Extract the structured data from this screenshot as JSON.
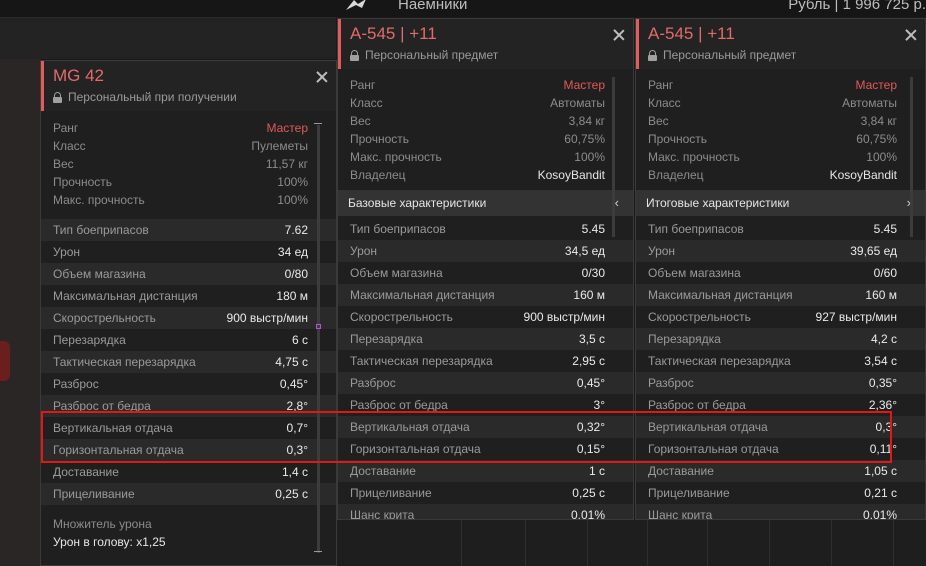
{
  "topbar": {
    "nav_label": "Наемники",
    "currency": "Рубль | 1 996 725 р."
  },
  "panels": {
    "mg42": {
      "title": "MG 42",
      "subtitle": "Персональный при получении",
      "info": [
        {
          "k": "Ранг",
          "v": "Мастер"
        },
        {
          "k": "Класс",
          "v": "Пулеметы"
        },
        {
          "k": "Вес",
          "v": "11,57 кг"
        },
        {
          "k": "Прочность",
          "v": "100%"
        },
        {
          "k": "Макс. прочность",
          "v": "100%"
        }
      ],
      "stats": [
        {
          "k": "Тип боеприпасов",
          "v": "7.62"
        },
        {
          "k": "Урон",
          "v": "34 ед"
        },
        {
          "k": "Объем магазина",
          "v": "0/80"
        },
        {
          "k": "Максимальная дистанция",
          "v": "180 м"
        },
        {
          "k": "Скорострельность",
          "v": "900 выстр/мин"
        },
        {
          "k": "Перезарядка",
          "v": "6 с"
        },
        {
          "k": "Тактическая перезарядка",
          "v": "4,75 с"
        },
        {
          "k": "Разброс",
          "v": "0,45°"
        },
        {
          "k": "Разброс от бедра",
          "v": "2,8°"
        },
        {
          "k": "Вертикальная отдача",
          "v": "0,7°"
        },
        {
          "k": "Горизонтальная отдача",
          "v": "0,3°"
        },
        {
          "k": "Доставание",
          "v": "1,4 с"
        },
        {
          "k": "Прицеливание",
          "v": "0,25 с"
        }
      ],
      "notes": {
        "multiplier": "Множитель урона",
        "head": "Урон в голову: x1,25"
      }
    },
    "ak_base": {
      "title": "A-545 | +11",
      "subtitle": "Персональный предмет",
      "info": [
        {
          "k": "Ранг",
          "v": "Мастер"
        },
        {
          "k": "Класс",
          "v": "Автоматы"
        },
        {
          "k": "Вес",
          "v": "3,84 кг"
        },
        {
          "k": "Прочность",
          "v": "60,75%"
        },
        {
          "k": "Макс. прочность",
          "v": "100%"
        },
        {
          "k": "Владелец",
          "v": "KosoyBandit"
        }
      ],
      "section": "Базовые характеристики",
      "chevron": "‹",
      "stats": [
        {
          "k": "Тип боеприпасов",
          "v": "5.45"
        },
        {
          "k": "Урон",
          "v": "34,5 ед"
        },
        {
          "k": "Объем магазина",
          "v": "0/30"
        },
        {
          "k": "Максимальная дистанция",
          "v": "160 м"
        },
        {
          "k": "Скорострельность",
          "v": "900 выстр/мин"
        },
        {
          "k": "Перезарядка",
          "v": "3,5 с"
        },
        {
          "k": "Тактическая перезарядка",
          "v": "2,95 с"
        },
        {
          "k": "Разброс",
          "v": "0,45°"
        },
        {
          "k": "Разброс от бедра",
          "v": "3°"
        },
        {
          "k": "Вертикальная отдача",
          "v": "0,32°"
        },
        {
          "k": "Горизонтальная отдача",
          "v": "0,15°"
        },
        {
          "k": "Доставание",
          "v": "1 с"
        },
        {
          "k": "Прицеливание",
          "v": "0,25 с"
        },
        {
          "k": "Шанс крита",
          "v": "0,01%"
        }
      ]
    },
    "ak_total": {
      "title": "A-545 | +11",
      "subtitle": "Персональный предмет",
      "info": [
        {
          "k": "Ранг",
          "v": "Мастер"
        },
        {
          "k": "Класс",
          "v": "Автоматы"
        },
        {
          "k": "Вес",
          "v": "3,84 кг"
        },
        {
          "k": "Прочность",
          "v": "60,75%"
        },
        {
          "k": "Макс. прочность",
          "v": "100%"
        },
        {
          "k": "Владелец",
          "v": "KosoyBandit"
        }
      ],
      "section": "Итоговые характеристики",
      "chevron": "›",
      "stats": [
        {
          "k": "Тип боеприпасов",
          "v": "5.45"
        },
        {
          "k": "Урон",
          "v": "39,65 ед"
        },
        {
          "k": "Объем магазина",
          "v": "0/60"
        },
        {
          "k": "Максимальная дистанция",
          "v": "160 м"
        },
        {
          "k": "Скорострельность",
          "v": "927 выстр/мин"
        },
        {
          "k": "Перезарядка",
          "v": "4,2 с"
        },
        {
          "k": "Тактическая перезарядка",
          "v": "3,54 с"
        },
        {
          "k": "Разброс",
          "v": "0,35°"
        },
        {
          "k": "Разброс от бедра",
          "v": "2,36°"
        },
        {
          "k": "Вертикальная отдача",
          "v": "0,3°"
        },
        {
          "k": "Горизонтальная отдача",
          "v": "0,11°"
        },
        {
          "k": "Доставание",
          "v": "1,05 с"
        },
        {
          "k": "Прицеливание",
          "v": "0,21 с"
        },
        {
          "k": "Шанс крита",
          "v": "0,01%"
        }
      ]
    }
  },
  "colors": {
    "accent": "#e35c5c",
    "rank": "#e05a5a",
    "highlight": "#e01818"
  },
  "icons": [
    "lock-icon",
    "close-icon",
    "chevron-icon",
    "logo-icon"
  ]
}
